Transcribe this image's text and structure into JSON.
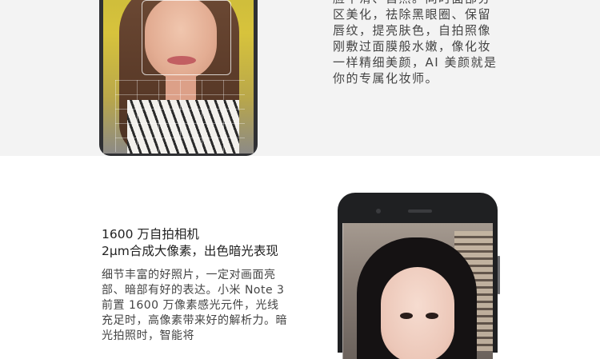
{
  "top_section": {
    "paragraph": "脸平滑、自然。同时面部分区美化，祛除黑眼圈、保留唇纹，提亮肤色，自拍照像刚敷过面膜般水嫩，像化妆一样精细美颜，AI 美颜就是你的专属化妆师。"
  },
  "bottom_section": {
    "title_line1": "1600 万自拍相机",
    "title_line2": "2μm合成大像素，出色暗光表现",
    "paragraph": "细节丰富的好照片，一定对画面亮部、暗部有好的表达。小米 Note 3 前置 1600 万像素感光元件，光线充足时，高像素带来好的解析力。暗光拍照时，智能将"
  },
  "colors": {
    "top_band_bg": "#f3f3f3",
    "bottom_band_bg": "#ffffff",
    "phone_body": "#2f3033"
  },
  "images": {
    "phone_top": "selfie-woman-yellow-background-icon",
    "phone_bottom": "selfie-woman-store-background-icon"
  }
}
